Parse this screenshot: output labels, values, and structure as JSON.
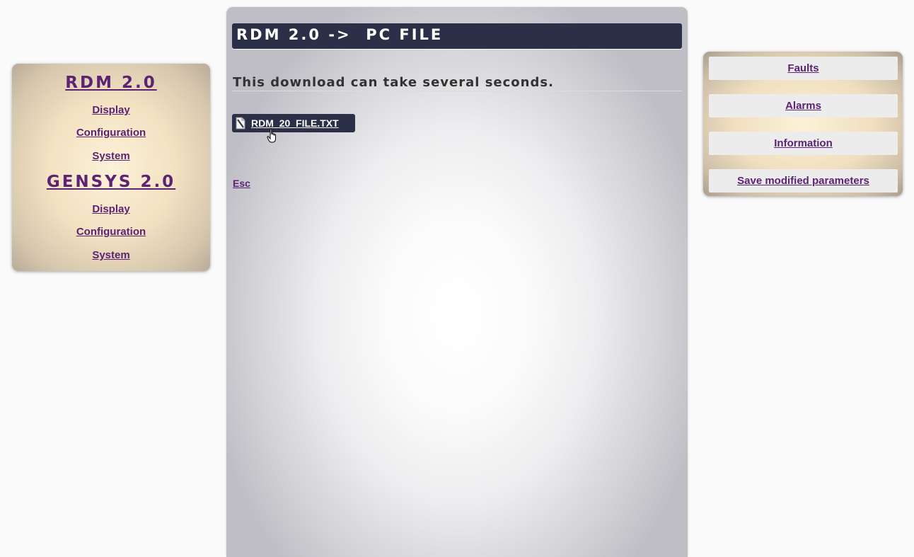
{
  "left_nav": {
    "rdm_title": "RDM 2.0",
    "rdm_links": [
      "Display",
      "Configuration",
      "System"
    ],
    "gensys_title": "GENSYS 2.0",
    "gensys_links": [
      "Display",
      "Configuration",
      "System"
    ]
  },
  "main": {
    "title": "RDM 2.0 ->  PC FILE",
    "message": "This download can take several seconds.",
    "file_name": "RDM_20_FILE.TXT",
    "esc_label": "Esc"
  },
  "right_nav": {
    "buttons": [
      "Faults",
      "Alarms",
      "Information",
      "Save modified parameters"
    ]
  },
  "colors": {
    "link": "#5b2372",
    "title_bar": "#2b3048"
  },
  "icons": {
    "file": "document-icon",
    "cursor": "hand-pointer-icon"
  }
}
